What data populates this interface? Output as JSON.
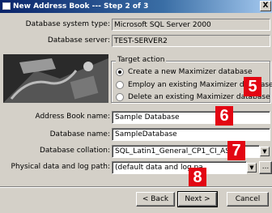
{
  "window": {
    "title": "New Address Book --- Step 2 of 3",
    "close_glyph": "X"
  },
  "info": {
    "db_system_type_label": "Database system type:",
    "db_system_type_value": "Microsoft SQL Server 2000",
    "db_server_label": "Database server:",
    "db_server_value": "TEST-SERVER2"
  },
  "target_action": {
    "legend": "Target action",
    "options": [
      "Create a new Maximizer database",
      "Employ an existing Maximizer database",
      "Delete an existing Maximizer database"
    ],
    "selected_index": 0
  },
  "form": {
    "address_book_name_label": "Address Book name:",
    "address_book_name_value": "Sample Database",
    "database_name_label": "Database name:",
    "database_name_value": "SampleDatabase",
    "collation_label": "Database collation:",
    "collation_value": "SQL_Latin1_General_CP1_CI_AS",
    "path_label": "Physical data and log path:",
    "path_value": "(default data and log pa",
    "browse_label": "..."
  },
  "badges": [
    "5",
    "6",
    "7",
    "8"
  ],
  "buttons": {
    "back": "< Back",
    "next": "Next >",
    "cancel": "Cancel"
  },
  "colors": {
    "badge": "#e30613",
    "titlebar": "#0a246a",
    "dialog_bg": "#d4d0c8"
  }
}
